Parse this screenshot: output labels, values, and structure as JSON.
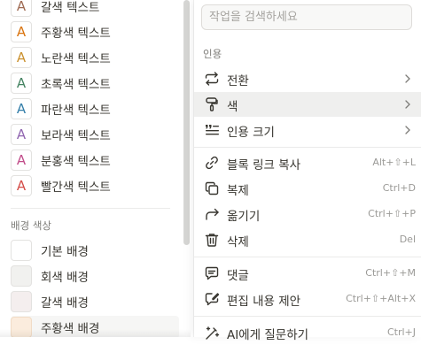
{
  "left_panel": {
    "text_colors": [
      {
        "label": "갈색 텍스트",
        "glyph": "A",
        "color": "#9f6b53"
      },
      {
        "label": "주황색 텍스트",
        "glyph": "A",
        "color": "#d9730d"
      },
      {
        "label": "노란색 텍스트",
        "glyph": "A",
        "color": "#cb912f"
      },
      {
        "label": "초록색 텍스트",
        "glyph": "A",
        "color": "#448361"
      },
      {
        "label": "파란색 텍스트",
        "glyph": "A",
        "color": "#337ea9"
      },
      {
        "label": "보라색 텍스트",
        "glyph": "A",
        "color": "#9065b0"
      },
      {
        "label": "분홍색 텍스트",
        "glyph": "A",
        "color": "#c14c8a"
      },
      {
        "label": "빨간색 텍스트",
        "glyph": "A",
        "color": "#d44c47"
      }
    ],
    "background_section_label": "배경 색상",
    "background_colors": [
      {
        "label": "기본 배경",
        "color": "#ffffff"
      },
      {
        "label": "회색 배경",
        "color": "#f1f1ef"
      },
      {
        "label": "갈색 배경",
        "color": "#f4eeee"
      },
      {
        "label": "주황색 배경",
        "color": "#fbecdd"
      }
    ]
  },
  "menu": {
    "search_placeholder": "작업을 검색하세요",
    "section_label": "인용",
    "items": [
      {
        "label": "전환",
        "icon": "turn-into-icon",
        "has_submenu": true,
        "shortcut": ""
      },
      {
        "label": "색",
        "icon": "paint-roller-icon",
        "has_submenu": true,
        "shortcut": "",
        "highlighted": true
      },
      {
        "label": "인용 크기",
        "icon": "quote-size-icon",
        "has_submenu": true,
        "shortcut": ""
      },
      {
        "label": "블록 링크 복사",
        "icon": "link-icon",
        "has_submenu": false,
        "shortcut": "Alt+⇧+L"
      },
      {
        "label": "복제",
        "icon": "duplicate-icon",
        "has_submenu": false,
        "shortcut": "Ctrl+D"
      },
      {
        "label": "옮기기",
        "icon": "move-arrow-icon",
        "has_submenu": false,
        "shortcut": "Ctrl+⇧+P"
      },
      {
        "label": "삭제",
        "icon": "trash-icon",
        "has_submenu": false,
        "shortcut": "Del"
      },
      {
        "label": "댓글",
        "icon": "comment-icon",
        "has_submenu": false,
        "shortcut": "Ctrl+⇧+M"
      },
      {
        "label": "편집 내용 제안",
        "icon": "suggest-edit-icon",
        "has_submenu": false,
        "shortcut": "Ctrl+⇧+Alt+X"
      },
      {
        "label": "AI에게 질문하기",
        "icon": "ai-icon",
        "has_submenu": false,
        "shortcut": "Ctrl+J"
      }
    ]
  }
}
